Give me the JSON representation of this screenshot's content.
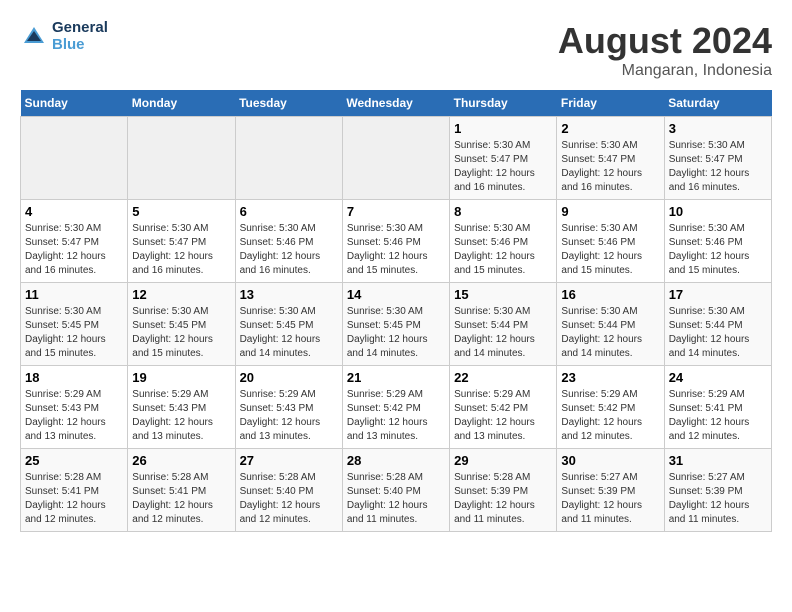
{
  "header": {
    "logo_line1": "General",
    "logo_line2": "Blue",
    "title": "August 2024",
    "subtitle": "Mangaran, Indonesia"
  },
  "weekdays": [
    "Sunday",
    "Monday",
    "Tuesday",
    "Wednesday",
    "Thursday",
    "Friday",
    "Saturday"
  ],
  "weeks": [
    [
      {
        "day": "",
        "empty": true
      },
      {
        "day": "",
        "empty": true
      },
      {
        "day": "",
        "empty": true
      },
      {
        "day": "",
        "empty": true
      },
      {
        "day": "1",
        "sunrise": "5:30 AM",
        "sunset": "5:47 PM",
        "daylight": "12 hours and 16 minutes."
      },
      {
        "day": "2",
        "sunrise": "5:30 AM",
        "sunset": "5:47 PM",
        "daylight": "12 hours and 16 minutes."
      },
      {
        "day": "3",
        "sunrise": "5:30 AM",
        "sunset": "5:47 PM",
        "daylight": "12 hours and 16 minutes."
      }
    ],
    [
      {
        "day": "4",
        "sunrise": "5:30 AM",
        "sunset": "5:47 PM",
        "daylight": "12 hours and 16 minutes."
      },
      {
        "day": "5",
        "sunrise": "5:30 AM",
        "sunset": "5:47 PM",
        "daylight": "12 hours and 16 minutes."
      },
      {
        "day": "6",
        "sunrise": "5:30 AM",
        "sunset": "5:46 PM",
        "daylight": "12 hours and 16 minutes."
      },
      {
        "day": "7",
        "sunrise": "5:30 AM",
        "sunset": "5:46 PM",
        "daylight": "12 hours and 15 minutes."
      },
      {
        "day": "8",
        "sunrise": "5:30 AM",
        "sunset": "5:46 PM",
        "daylight": "12 hours and 15 minutes."
      },
      {
        "day": "9",
        "sunrise": "5:30 AM",
        "sunset": "5:46 PM",
        "daylight": "12 hours and 15 minutes."
      },
      {
        "day": "10",
        "sunrise": "5:30 AM",
        "sunset": "5:46 PM",
        "daylight": "12 hours and 15 minutes."
      }
    ],
    [
      {
        "day": "11",
        "sunrise": "5:30 AM",
        "sunset": "5:45 PM",
        "daylight": "12 hours and 15 minutes."
      },
      {
        "day": "12",
        "sunrise": "5:30 AM",
        "sunset": "5:45 PM",
        "daylight": "12 hours and 15 minutes."
      },
      {
        "day": "13",
        "sunrise": "5:30 AM",
        "sunset": "5:45 PM",
        "daylight": "12 hours and 14 minutes."
      },
      {
        "day": "14",
        "sunrise": "5:30 AM",
        "sunset": "5:45 PM",
        "daylight": "12 hours and 14 minutes."
      },
      {
        "day": "15",
        "sunrise": "5:30 AM",
        "sunset": "5:44 PM",
        "daylight": "12 hours and 14 minutes."
      },
      {
        "day": "16",
        "sunrise": "5:30 AM",
        "sunset": "5:44 PM",
        "daylight": "12 hours and 14 minutes."
      },
      {
        "day": "17",
        "sunrise": "5:30 AM",
        "sunset": "5:44 PM",
        "daylight": "12 hours and 14 minutes."
      }
    ],
    [
      {
        "day": "18",
        "sunrise": "5:29 AM",
        "sunset": "5:43 PM",
        "daylight": "12 hours and 13 minutes."
      },
      {
        "day": "19",
        "sunrise": "5:29 AM",
        "sunset": "5:43 PM",
        "daylight": "12 hours and 13 minutes."
      },
      {
        "day": "20",
        "sunrise": "5:29 AM",
        "sunset": "5:43 PM",
        "daylight": "12 hours and 13 minutes."
      },
      {
        "day": "21",
        "sunrise": "5:29 AM",
        "sunset": "5:42 PM",
        "daylight": "12 hours and 13 minutes."
      },
      {
        "day": "22",
        "sunrise": "5:29 AM",
        "sunset": "5:42 PM",
        "daylight": "12 hours and 13 minutes."
      },
      {
        "day": "23",
        "sunrise": "5:29 AM",
        "sunset": "5:42 PM",
        "daylight": "12 hours and 12 minutes."
      },
      {
        "day": "24",
        "sunrise": "5:29 AM",
        "sunset": "5:41 PM",
        "daylight": "12 hours and 12 minutes."
      }
    ],
    [
      {
        "day": "25",
        "sunrise": "5:28 AM",
        "sunset": "5:41 PM",
        "daylight": "12 hours and 12 minutes."
      },
      {
        "day": "26",
        "sunrise": "5:28 AM",
        "sunset": "5:41 PM",
        "daylight": "12 hours and 12 minutes."
      },
      {
        "day": "27",
        "sunrise": "5:28 AM",
        "sunset": "5:40 PM",
        "daylight": "12 hours and 12 minutes."
      },
      {
        "day": "28",
        "sunrise": "5:28 AM",
        "sunset": "5:40 PM",
        "daylight": "12 hours and 11 minutes."
      },
      {
        "day": "29",
        "sunrise": "5:28 AM",
        "sunset": "5:39 PM",
        "daylight": "12 hours and 11 minutes."
      },
      {
        "day": "30",
        "sunrise": "5:27 AM",
        "sunset": "5:39 PM",
        "daylight": "12 hours and 11 minutes."
      },
      {
        "day": "31",
        "sunrise": "5:27 AM",
        "sunset": "5:39 PM",
        "daylight": "12 hours and 11 minutes."
      }
    ]
  ]
}
